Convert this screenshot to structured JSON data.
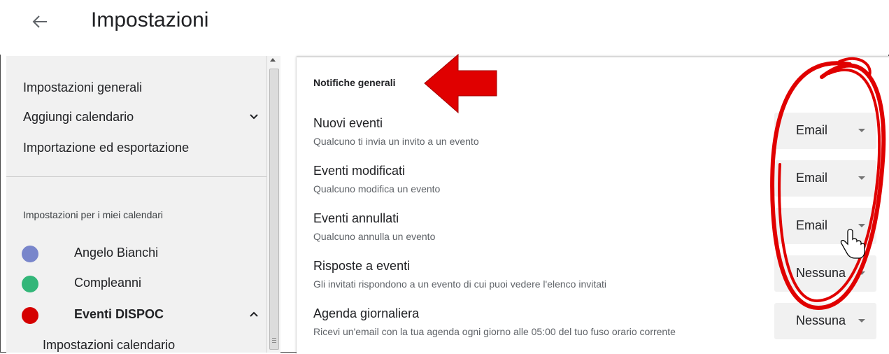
{
  "header": {
    "title": "Impostazioni",
    "back_icon": "arrow-left-icon"
  },
  "sidebar": {
    "items": [
      {
        "label": "Impostazioni generali"
      },
      {
        "label": "Aggiungi calendario",
        "icon": "chevron-down-icon"
      },
      {
        "label": "Importazione ed esportazione"
      }
    ],
    "section_title": "Impostazioni per i miei calendari",
    "calendars": [
      {
        "name": "Angelo Bianchi",
        "color": "#7986cb"
      },
      {
        "name": "Compleanni",
        "color": "#33b679"
      },
      {
        "name": "Eventi DISPOC",
        "color": "#d50000",
        "expanded": true,
        "icon": "chevron-up-icon"
      }
    ],
    "sub_item": "Impostazioni calendario"
  },
  "panel": {
    "title": "Notifiche generali",
    "rows": [
      {
        "label": "Nuovi eventi",
        "description": "Qualcuno ti invia un invito a un evento",
        "value": "Email"
      },
      {
        "label": "Eventi modificati",
        "description": "Qualcuno modifica un evento",
        "value": "Email"
      },
      {
        "label": "Eventi annullati",
        "description": "Qualcuno annulla un evento",
        "value": "Email"
      },
      {
        "label": "Risposte a eventi",
        "description": "Gli invitati rispondono a un evento di cui puoi vedere l'elenco invitati",
        "value": "Nessuna"
      },
      {
        "label": "Agenda giornaliera",
        "description": "Ricevi un'email con la tua agenda ogni giorno alle 05:00 del tuo fuso orario corrente",
        "value": "Nessuna"
      }
    ]
  },
  "annotations": {
    "arrow_color": "#e00000",
    "circle_color": "#e00000",
    "cursor_icon": "hand-pointer-icon"
  }
}
